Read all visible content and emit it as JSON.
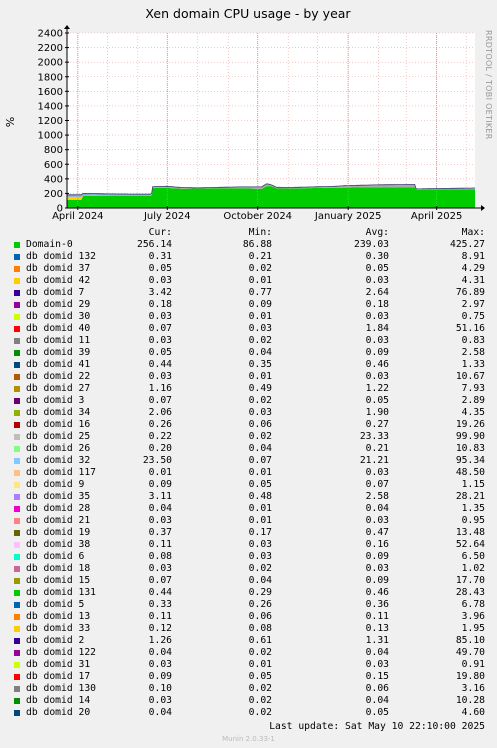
{
  "chart_data": {
    "type": "area",
    "title": "Xen domain CPU usage - by year",
    "ylabel": "%",
    "side_label": "RRDTOOL / TOBI OETIKER",
    "ylim": [
      0,
      2400
    ],
    "yticks": [
      0,
      200,
      400,
      600,
      800,
      1000,
      1200,
      1400,
      1600,
      1800,
      2000,
      2200,
      2400
    ],
    "x_range": [
      "2024-03-21",
      "2025-05-10"
    ],
    "xticks": [
      {
        "label": "April 2024",
        "date": "2024-04-01"
      },
      {
        "label": "July 2024",
        "date": "2024-07-01"
      },
      {
        "label": "October 2024",
        "date": "2024-10-01"
      },
      {
        "label": "January 2025",
        "date": "2025-01-01"
      },
      {
        "label": "April 2025",
        "date": "2025-04-01"
      }
    ],
    "grid": true,
    "stacked": true,
    "series_colors": {
      "Domain-0": "#00cc00",
      "db domid 132": "#0066b3",
      "db domid 37": "#ff8000",
      "db domid 7": "#ffcc00",
      "db domid 25": "#aaaaaa",
      "db domid 32": "#7bb0d0"
    },
    "area_series": [
      {
        "name": "Domain-0",
        "x": [
          "2024-03-21",
          "2024-04-05",
          "2024-04-06",
          "2024-05-25",
          "2024-05-26",
          "2024-06-15",
          "2024-06-16",
          "2024-07-01",
          "2024-07-15",
          "2024-08-15",
          "2024-09-15",
          "2024-10-05",
          "2024-10-10",
          "2024-10-15",
          "2024-10-20",
          "2024-11-01",
          "2024-12-01",
          "2025-01-01",
          "2025-02-01",
          "2025-03-01",
          "2025-03-10",
          "2025-03-11",
          "2025-04-01",
          "2025-05-10"
        ],
        "y": [
          110,
          110,
          170,
          165,
          165,
          165,
          275,
          275,
          265,
          270,
          272,
          260,
          300,
          300,
          268,
          268,
          275,
          280,
          285,
          285,
          285,
          250,
          255,
          255
        ]
      },
      {
        "name": "db domid 7",
        "x": [
          "2024-03-21",
          "2024-04-05",
          "2024-04-06",
          "2024-05-10"
        ],
        "y": [
          40,
          40,
          0,
          0
        ]
      },
      {
        "name": "db domid 25",
        "x": [
          "2024-03-21",
          "2024-06-15",
          "2024-06-16",
          "2024-07-01",
          "2024-08-01",
          "2024-09-15",
          "2024-10-10",
          "2024-10-15",
          "2024-11-01",
          "2024-12-15",
          "2025-01-01",
          "2025-02-01",
          "2025-03-10",
          "2025-03-11",
          "2025-04-01",
          "2025-05-10"
        ],
        "y": [
          5,
          5,
          15,
          20,
          5,
          15,
          30,
          15,
          10,
          15,
          25,
          30,
          35,
          5,
          5,
          10
        ]
      },
      {
        "name": "db domid 32",
        "x": [
          "2024-03-21",
          "2024-04-05",
          "2024-05-01",
          "2024-06-15",
          "2024-06-16",
          "2025-03-10",
          "2025-03-11",
          "2025-05-10"
        ],
        "y": [
          25,
          25,
          20,
          20,
          2,
          2,
          5,
          8
        ]
      },
      {
        "name": "db domid 132",
        "x": [
          "2024-03-21",
          "2025-05-10"
        ],
        "y": [
          1,
          1
        ]
      }
    ],
    "legend_headers": [
      "Cur:",
      "Min:",
      "Avg:",
      "Max:"
    ],
    "legend": [
      {
        "name": "Domain-0",
        "color": "#00cc00",
        "cur": "256.14",
        "min": "86.88",
        "avg": "239.03",
        "max": "425.27"
      },
      {
        "name": "db domid 132",
        "color": "#0066b3",
        "cur": "0.31",
        "min": "0.21",
        "avg": "0.30",
        "max": "8.91"
      },
      {
        "name": "db domid 37",
        "color": "#ff8000",
        "cur": "0.05",
        "min": "0.02",
        "avg": "0.05",
        "max": "4.29"
      },
      {
        "name": "db domid 42",
        "color": "#ffcc00",
        "cur": "0.03",
        "min": "0.01",
        "avg": "0.03",
        "max": "4.31"
      },
      {
        "name": "db domid 7",
        "color": "#330099",
        "cur": "3.42",
        "min": "0.77",
        "avg": "2.64",
        "max": "76.89"
      },
      {
        "name": "db domid 29",
        "color": "#990099",
        "cur": "0.18",
        "min": "0.09",
        "avg": "0.18",
        "max": "2.97"
      },
      {
        "name": "db domid 30",
        "color": "#ccff00",
        "cur": "0.03",
        "min": "0.01",
        "avg": "0.03",
        "max": "0.75"
      },
      {
        "name": "db domid 40",
        "color": "#ff0000",
        "cur": "0.07",
        "min": "0.03",
        "avg": "1.84",
        "max": "51.16"
      },
      {
        "name": "db domid 11",
        "color": "#808080",
        "cur": "0.03",
        "min": "0.02",
        "avg": "0.03",
        "max": "0.83"
      },
      {
        "name": "db domid 39",
        "color": "#008f00",
        "cur": "0.05",
        "min": "0.04",
        "avg": "0.09",
        "max": "2.58"
      },
      {
        "name": "db domid 41",
        "color": "#00487d",
        "cur": "0.44",
        "min": "0.35",
        "avg": "0.46",
        "max": "1.33"
      },
      {
        "name": "db domid 22",
        "color": "#b35a00",
        "cur": "0.03",
        "min": "0.01",
        "avg": "0.03",
        "max": "10.67"
      },
      {
        "name": "db domid 27",
        "color": "#b38f00",
        "cur": "1.16",
        "min": "0.49",
        "avg": "1.22",
        "max": "7.93"
      },
      {
        "name": "db domid 3",
        "color": "#6b006b",
        "cur": "0.07",
        "min": "0.02",
        "avg": "0.05",
        "max": "2.89"
      },
      {
        "name": "db domid 34",
        "color": "#8fb300",
        "cur": "2.06",
        "min": "0.03",
        "avg": "1.90",
        "max": "4.35"
      },
      {
        "name": "db domid 16",
        "color": "#b30000",
        "cur": "0.26",
        "min": "0.06",
        "avg": "0.27",
        "max": "19.26"
      },
      {
        "name": "db domid 25",
        "color": "#bebebe",
        "cur": "0.22",
        "min": "0.02",
        "avg": "23.33",
        "max": "99.90"
      },
      {
        "name": "db domid 26",
        "color": "#80ff80",
        "cur": "0.20",
        "min": "0.04",
        "avg": "0.21",
        "max": "10.83"
      },
      {
        "name": "db domid 32",
        "color": "#80c9ff",
        "cur": "23.50",
        "min": "0.07",
        "avg": "21.21",
        "max": "95.34"
      },
      {
        "name": "db domid 117",
        "color": "#ffc080",
        "cur": "0.01",
        "min": "0.01",
        "avg": "0.03",
        "max": "48.50"
      },
      {
        "name": "db domid 9",
        "color": "#ffe680",
        "cur": "0.09",
        "min": "0.05",
        "avg": "0.07",
        "max": "1.15"
      },
      {
        "name": "db domid 35",
        "color": "#aa80ff",
        "cur": "3.11",
        "min": "0.48",
        "avg": "2.58",
        "max": "28.21"
      },
      {
        "name": "db domid 28",
        "color": "#ee00cc",
        "cur": "0.04",
        "min": "0.01",
        "avg": "0.04",
        "max": "1.35"
      },
      {
        "name": "db domid 21",
        "color": "#ff8080",
        "cur": "0.03",
        "min": "0.01",
        "avg": "0.03",
        "max": "0.95"
      },
      {
        "name": "db domid 19",
        "color": "#666600",
        "cur": "0.37",
        "min": "0.17",
        "avg": "0.47",
        "max": "13.48"
      },
      {
        "name": "db domid 38",
        "color": "#ffbfff",
        "cur": "0.11",
        "min": "0.03",
        "avg": "0.16",
        "max": "52.64"
      },
      {
        "name": "db domid 6",
        "color": "#00ffcc",
        "cur": "0.08",
        "min": "0.03",
        "avg": "0.09",
        "max": "6.50"
      },
      {
        "name": "db domid 18",
        "color": "#cc6699",
        "cur": "0.03",
        "min": "0.02",
        "avg": "0.03",
        "max": "1.02"
      },
      {
        "name": "db domid 15",
        "color": "#999900",
        "cur": "0.07",
        "min": "0.04",
        "avg": "0.09",
        "max": "17.70"
      },
      {
        "name": "db domid 131",
        "color": "#00cc00",
        "cur": "0.44",
        "min": "0.29",
        "avg": "0.46",
        "max": "28.43"
      },
      {
        "name": "db domid 5",
        "color": "#0066b3",
        "cur": "0.33",
        "min": "0.26",
        "avg": "0.36",
        "max": "6.78"
      },
      {
        "name": "db domid 13",
        "color": "#ff8000",
        "cur": "0.11",
        "min": "0.06",
        "avg": "0.11",
        "max": "3.96"
      },
      {
        "name": "db domid 33",
        "color": "#ffcc00",
        "cur": "0.12",
        "min": "0.08",
        "avg": "0.13",
        "max": "1.95"
      },
      {
        "name": "db domid 2",
        "color": "#330099",
        "cur": "1.26",
        "min": "0.61",
        "avg": "1.31",
        "max": "85.10"
      },
      {
        "name": "db domid 122",
        "color": "#990099",
        "cur": "0.04",
        "min": "0.02",
        "avg": "0.04",
        "max": "49.70"
      },
      {
        "name": "db domid 31",
        "color": "#ccff00",
        "cur": "0.03",
        "min": "0.01",
        "avg": "0.03",
        "max": "0.91"
      },
      {
        "name": "db domid 17",
        "color": "#ff0000",
        "cur": "0.09",
        "min": "0.05",
        "avg": "0.15",
        "max": "19.80"
      },
      {
        "name": "db domid 130",
        "color": "#808080",
        "cur": "0.10",
        "min": "0.02",
        "avg": "0.06",
        "max": "3.16"
      },
      {
        "name": "db domid 14",
        "color": "#008f00",
        "cur": "0.03",
        "min": "0.02",
        "avg": "0.04",
        "max": "10.28"
      },
      {
        "name": "db domid 20",
        "color": "#00487d",
        "cur": "0.04",
        "min": "0.02",
        "avg": "0.05",
        "max": "4.60"
      }
    ]
  },
  "footer": {
    "last_update": "Last update:  Sat May 10 22:10:00 2025",
    "version": "Munin 2.0.33-1"
  }
}
